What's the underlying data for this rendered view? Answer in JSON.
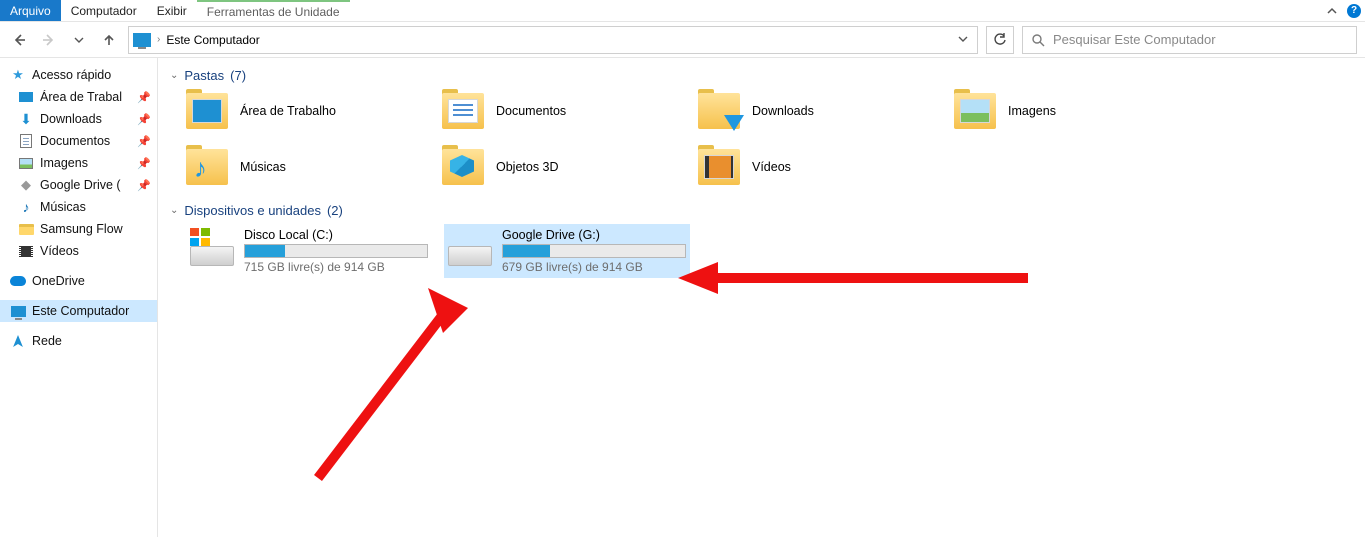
{
  "menubar": {
    "file": "Arquivo",
    "computer": "Computador",
    "view": "Exibir",
    "drive_tools": "Ferramentas de Unidade"
  },
  "address": {
    "location": "Este Computador"
  },
  "search": {
    "placeholder": "Pesquisar Este Computador"
  },
  "sidebar": {
    "quick_access": "Acesso rápido",
    "desktop": "Área de Trabal",
    "downloads": "Downloads",
    "documents": "Documentos",
    "pictures": "Imagens",
    "google_drive": "Google Drive (",
    "music": "Músicas",
    "samsung_flow": "Samsung Flow",
    "videos": "Vídeos",
    "onedrive": "OneDrive",
    "this_pc": "Este Computador",
    "network": "Rede"
  },
  "groups": {
    "folders": {
      "label": "Pastas",
      "count": "(7)"
    },
    "drives": {
      "label": "Dispositivos e unidades",
      "count": "(2)"
    }
  },
  "folders": {
    "desktop": "Área de Trabalho",
    "documents": "Documentos",
    "downloads": "Downloads",
    "pictures": "Imagens",
    "music": "Músicas",
    "objects3d": "Objetos 3D",
    "videos": "Vídeos"
  },
  "drives": {
    "c": {
      "name": "Disco Local (C:)",
      "sub": "715 GB livre(s) de 914 GB",
      "fill_pct": 22
    },
    "g": {
      "name": "Google Drive (G:)",
      "sub": "679 GB livre(s) de 914 GB",
      "fill_pct": 26
    }
  }
}
